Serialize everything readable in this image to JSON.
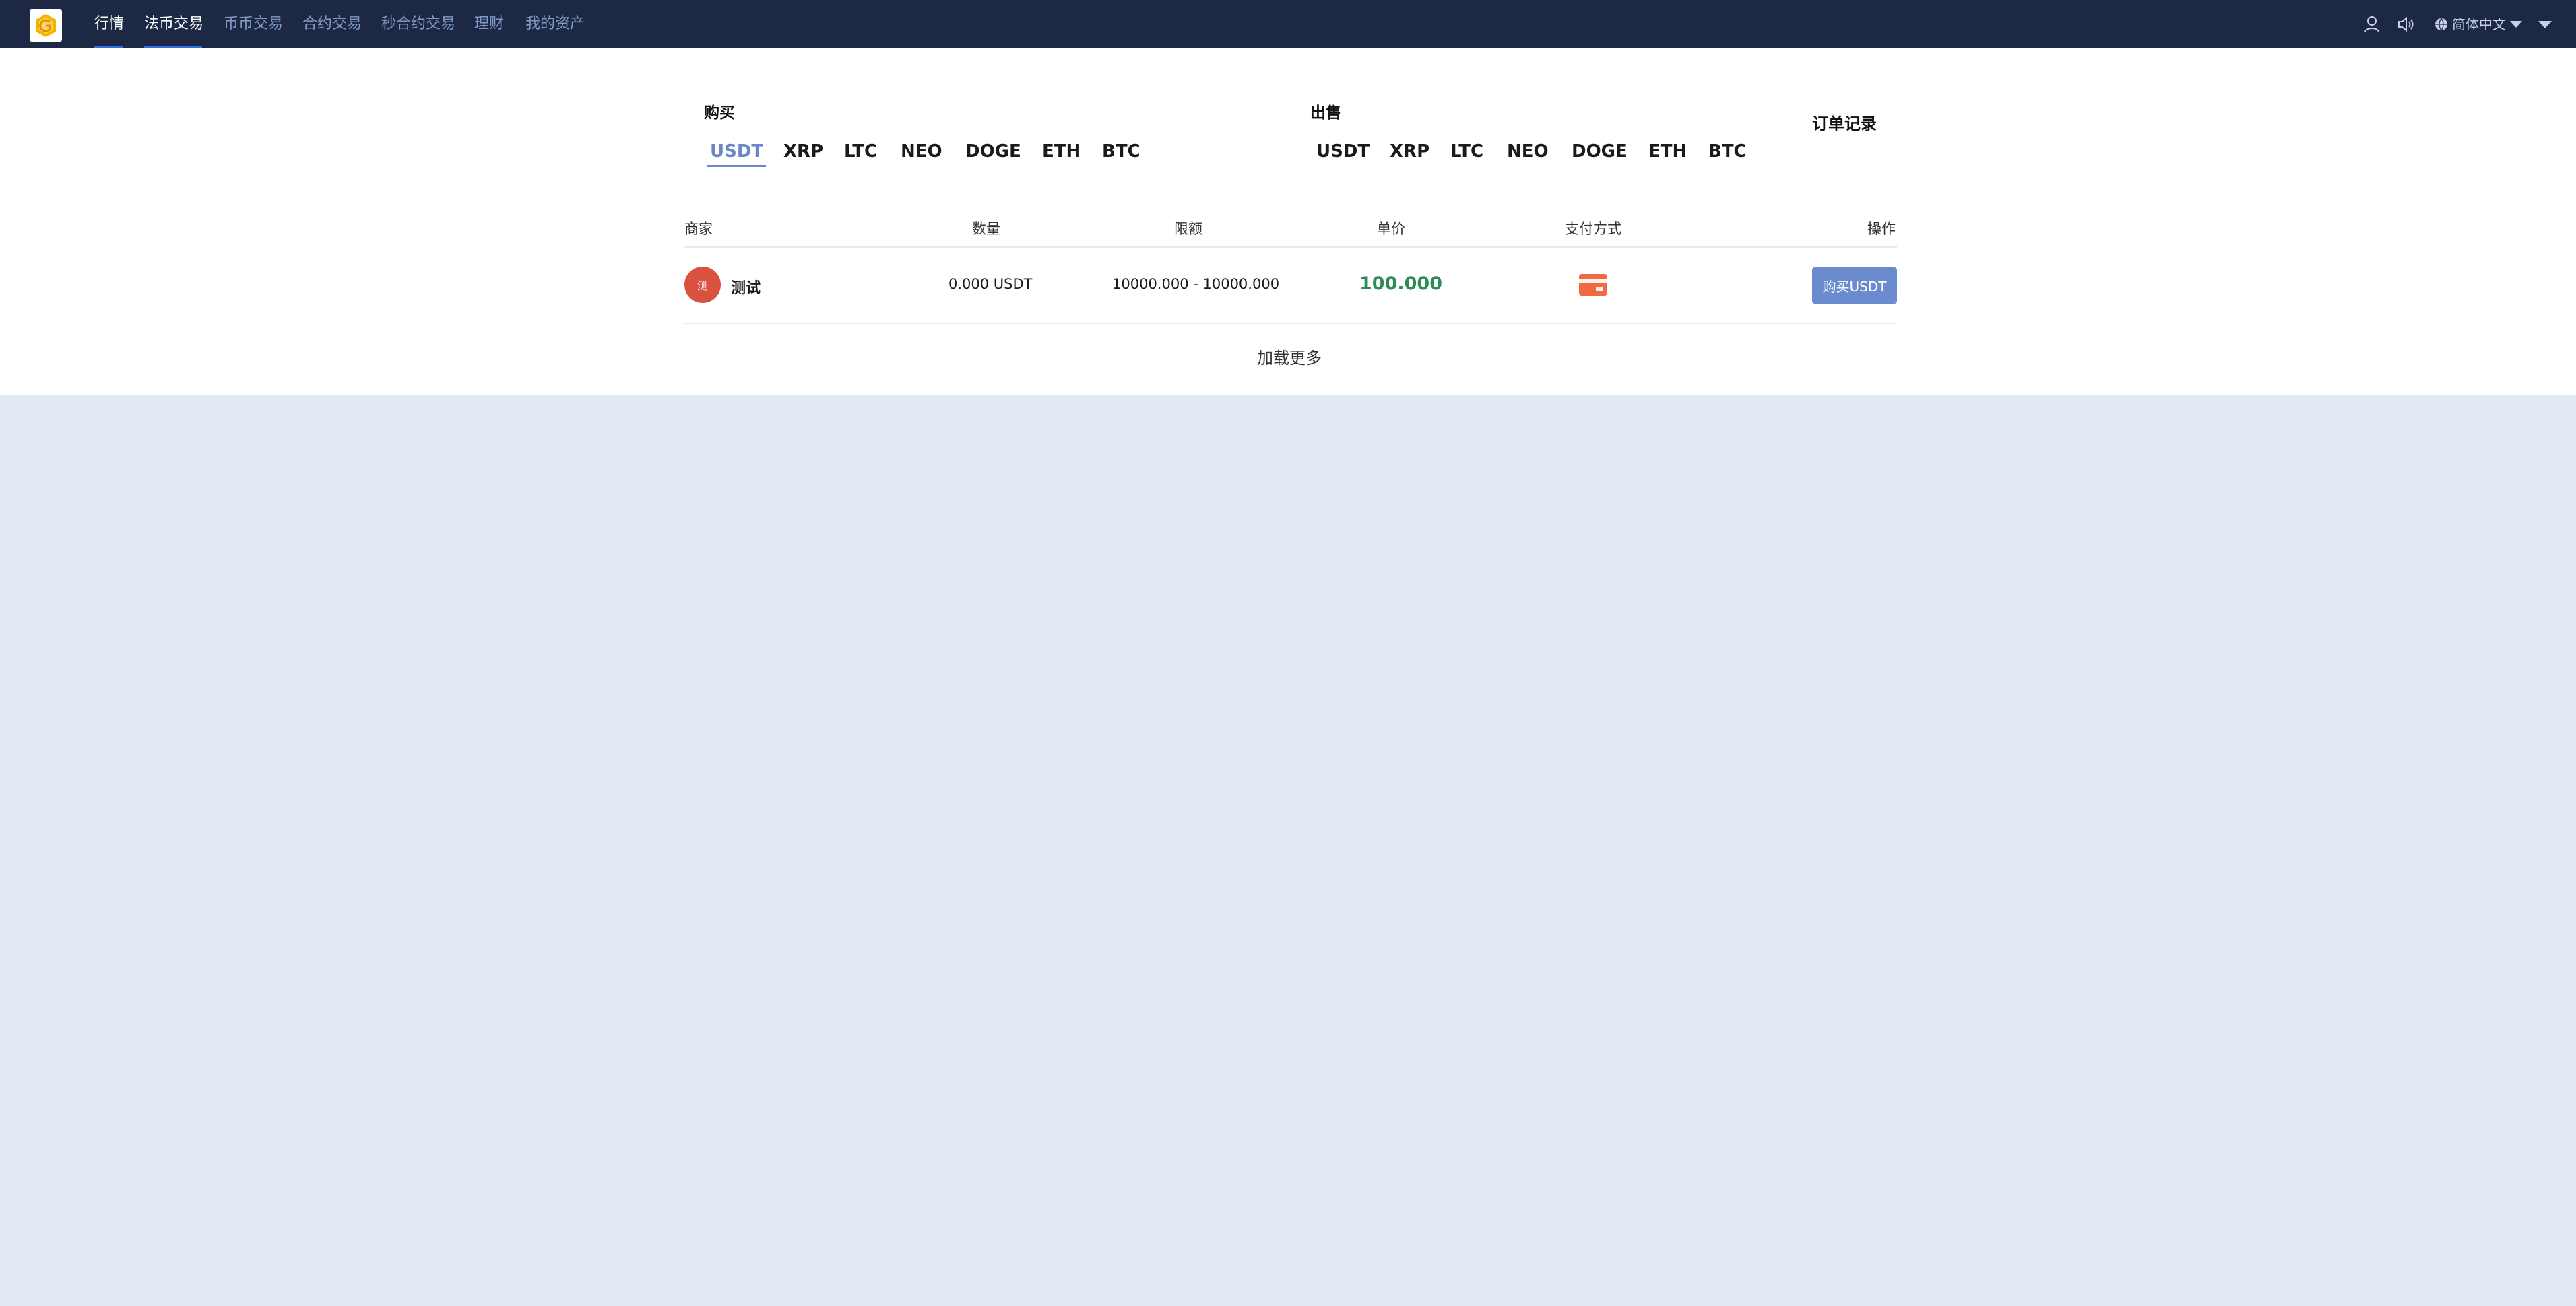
{
  "nav": {
    "items": [
      {
        "label": "行情"
      },
      {
        "label": "法币交易"
      },
      {
        "label": "币币交易"
      },
      {
        "label": "合约交易"
      },
      {
        "label": "秒合约交易"
      },
      {
        "label": "理财"
      },
      {
        "label": "我的资产"
      }
    ],
    "language": "简体中文",
    "icons": [
      "logo-icon",
      "user-icon",
      "speaker-icon",
      "globe-icon"
    ]
  },
  "buy": {
    "title": "购买",
    "coins": [
      "USDT",
      "XRP",
      "LTC",
      "NEO",
      "DOGE",
      "ETH",
      "BTC"
    ],
    "active": "USDT"
  },
  "sell": {
    "title": "出售",
    "coins": [
      "USDT",
      "XRP",
      "LTC",
      "NEO",
      "DOGE",
      "ETH",
      "BTC"
    ]
  },
  "order_record": "订单记录",
  "table": {
    "headers": [
      "商家",
      "数量",
      "限额",
      "单价",
      "支付方式",
      "操作"
    ],
    "rows": [
      {
        "avatar": "测",
        "merchant": "测试",
        "quantity": "0.000 USDT",
        "limit": "10000.000 - 10000.000",
        "price": "100.000",
        "payment_icon": "bank-card-icon",
        "action": "购买USDT"
      }
    ]
  },
  "load_more": "加载更多",
  "colors": {
    "nav_bg": "#1c2844",
    "accent": "#6b86c9",
    "price": "#2e8b57",
    "card": "#ee6a43",
    "page_bg": "#e3e9f3"
  }
}
